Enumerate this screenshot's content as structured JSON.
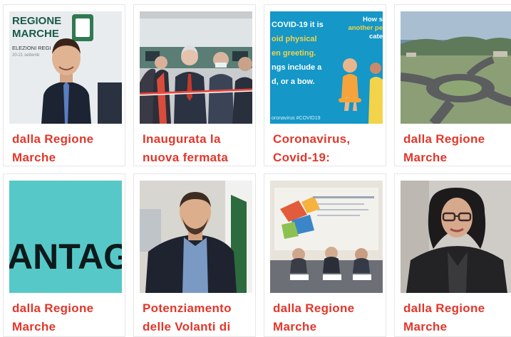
{
  "accent_color": "#e2372a",
  "cards": [
    {
      "title": "dalla Regione Marche",
      "image": {
        "caption_lines": [
          "REGIONE",
          "MARCHE",
          "ELEZIONI REGI",
          "20-21 settemb"
        ]
      }
    },
    {
      "title": "Inaugurata la nuova fermata",
      "image": {}
    },
    {
      "title": "Coronavirus, Covid-19:",
      "image": {
        "lines": [
          "COVID-19 it is",
          "oid physical",
          "en greeting.",
          "ngs include a",
          "d, or a bow."
        ],
        "top_right": [
          "How s",
          "another pe",
          "cate"
        ],
        "footer": "oronavirus  #COVID19"
      }
    },
    {
      "title": "dalla Regione Marche",
      "image": {}
    },
    {
      "title": "dalla Regione Marche",
      "image": {
        "text": "ANTAG"
      }
    },
    {
      "title": "Potenziamento delle Volanti di",
      "image": {}
    },
    {
      "title": "dalla Regione Marche",
      "image": {}
    },
    {
      "title": "dalla Regione Marche",
      "image": {}
    }
  ]
}
